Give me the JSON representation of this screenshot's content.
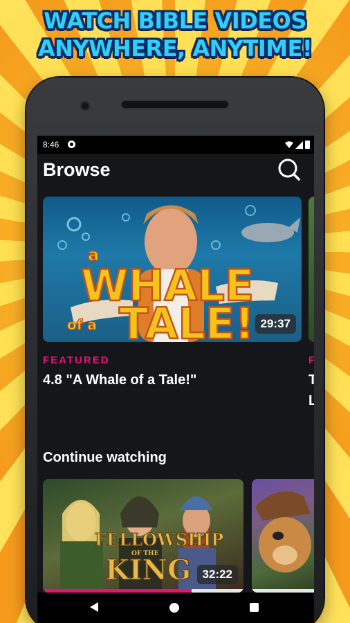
{
  "promo": {
    "headline_line1": "WATCH BIBLE VIDEOS",
    "headline_line2": "ANYWHERE, ANYTIME!"
  },
  "status_bar": {
    "time": "8:46",
    "icons": [
      "app-notification-icon",
      "wifi-icon",
      "signal-icon",
      "battery-icon"
    ]
  },
  "header": {
    "title": "Browse",
    "search_icon": "search-icon"
  },
  "featured": {
    "duration": "29:37",
    "label": "FEATURED",
    "title": "4.8 \"A Whale of a Tale!\"",
    "thumbnail_text_line1": "a",
    "thumbnail_text_line2": "WHALE",
    "thumbnail_text_line3": "of a",
    "thumbnail_text_line4": "TALE!",
    "next_label_peek": "F",
    "next_title_peek_1": "T",
    "next_title_peek_2": "L"
  },
  "continue_watching": {
    "title": "Continue watching",
    "items": [
      {
        "thumbnail_text_line1": "FELLOWSHIP",
        "thumbnail_text_line2": "OF THE",
        "thumbnail_text_line3": "KING",
        "duration": "32:22",
        "progress": 0.74
      },
      {
        "progress": 0.0
      }
    ]
  },
  "nav_bar": {
    "icons": [
      "back-icon",
      "home-icon",
      "recents-icon"
    ]
  },
  "colors": {
    "accent": "#e3137a",
    "screen_bg": "#15161a",
    "headline": "#2fd0f5"
  }
}
